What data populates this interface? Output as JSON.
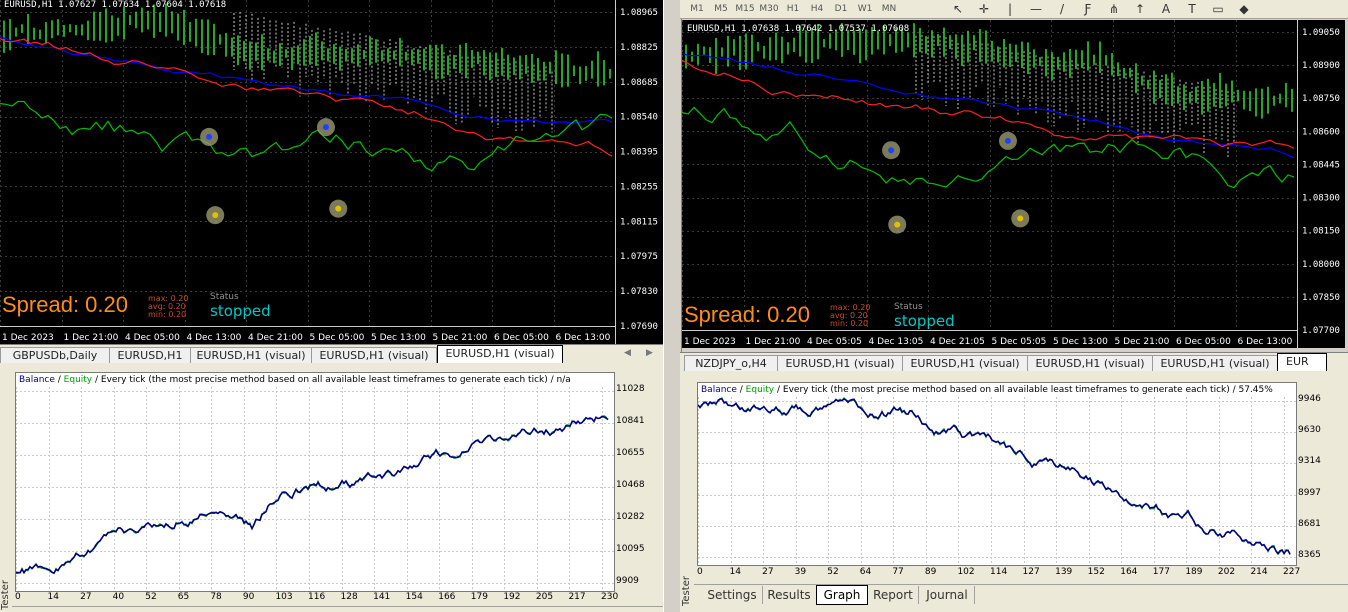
{
  "left": {
    "chart": {
      "header": "EURUSD,H1  1.07627 1.07634 1.07604 1.07618",
      "price_labels": [
        "1.08965",
        "1.08825",
        "1.08685",
        "1.08540",
        "1.08395",
        "1.08255",
        "1.08115",
        "1.07975",
        "1.07830",
        "1.07690"
      ],
      "time_labels": [
        "1 Dec 2023",
        "1 Dec 21:00",
        "4 Dec 05:00",
        "4 Dec 13:00",
        "4 Dec 21:00",
        "5 Dec 05:00",
        "5 Dec 13:00",
        "5 Dec 21:00",
        "6 Dec 05:00",
        "6 Dec 13:00"
      ],
      "spread": "Spread: 0.20",
      "max": "max: 0.20",
      "avg": "avg: 0.20",
      "min": "min: 0.20",
      "status_label": "Status",
      "status_value": "stopped"
    },
    "tabs": [
      "GBPUSDb,Daily",
      "EURUSD,H1",
      "EURUSD,H1 (visual)",
      "EURUSD,H1 (visual)",
      "EURUSD,H1 (visual)"
    ],
    "graph": {
      "legend_balance": "Balance",
      "legend_sep": " / ",
      "legend_equity": "Equity",
      "legend_rest": " / Every tick (the most precise method based on all available least timeframes to generate each tick) / n/a",
      "y_labels": [
        "11028",
        "10841",
        "10655",
        "10468",
        "10282",
        "10095",
        "9909"
      ],
      "x_labels": [
        "0",
        "14",
        "27",
        "40",
        "52",
        "65",
        "78",
        "90",
        "103",
        "116",
        "128",
        "141",
        "154",
        "166",
        "179",
        "192",
        "205",
        "217",
        "230"
      ]
    },
    "sidebar_label": "Tester"
  },
  "right": {
    "toolbar": {
      "timeframes": [
        "M1",
        "M5",
        "M15",
        "M30",
        "H1",
        "H4",
        "D1",
        "W1",
        "MN"
      ],
      "icons": [
        "cursor-icon",
        "crosshair-icon",
        "vertical-line-icon",
        "horizontal-line-icon",
        "trendline-icon",
        "fibonacci-icon",
        "fibo-fan-icon",
        "arrow-up-icon",
        "text-icon",
        "label-icon",
        "rectangle-icon",
        "shapes-icon"
      ]
    },
    "chart": {
      "header": "EURUSD,H1  1.07638 1.07642 1.07537 1.07608",
      "price_labels": [
        "1.09050",
        "1.08900",
        "1.08750",
        "1.08600",
        "1.08445",
        "1.08300",
        "1.08150",
        "1.08000",
        "1.07850",
        "1.07700"
      ],
      "time_labels": [
        "1 Dec 2023",
        "1 Dec 21:00",
        "4 Dec 05:05",
        "4 Dec 13:05",
        "4 Dec 21:05",
        "5 Dec 05:05",
        "5 Dec 13:00",
        "5 Dec 21:00",
        "6 Dec 05:00",
        "6 Dec 13:00"
      ],
      "spread": "Spread: 0.20",
      "max": "max: 0.20",
      "avg": "avg: 0.20",
      "min": "min: 0.20",
      "status_label": "Status",
      "status_value": "stopped"
    },
    "tabs": [
      "NZDJPY_o,H4",
      "EURUSD,H1 (visual)",
      "EURUSD,H1 (visual)",
      "EURUSD,H1 (visual)",
      "EURUSD,H1 (visual)",
      "EUR"
    ],
    "graph": {
      "legend_balance": "Balance",
      "legend_sep": " / ",
      "legend_equity": "Equity",
      "legend_rest": " / Every tick (the most precise method based on all available least timeframes to generate each tick) / 57.45%",
      "y_labels": [
        "9946",
        "9630",
        "9314",
        "8997",
        "8681",
        "8365"
      ],
      "x_labels": [
        "0",
        "14",
        "27",
        "39",
        "52",
        "64",
        "77",
        "89",
        "102",
        "114",
        "127",
        "139",
        "152",
        "164",
        "177",
        "189",
        "202",
        "214",
        "227"
      ]
    },
    "bottom_tabs": [
      "Settings",
      "Results",
      "Graph",
      "Report",
      "Journal"
    ],
    "sidebar_label": "Tester"
  },
  "colors": {
    "balance": "#00007f",
    "equity": "#00a000",
    "cloud": "#ffffff",
    "kijun": "#0000ff",
    "tenkan": "#ff0000",
    "chikou": "#00c000",
    "spread": "#ff8c1a",
    "stopped": "#00c8c8"
  }
}
